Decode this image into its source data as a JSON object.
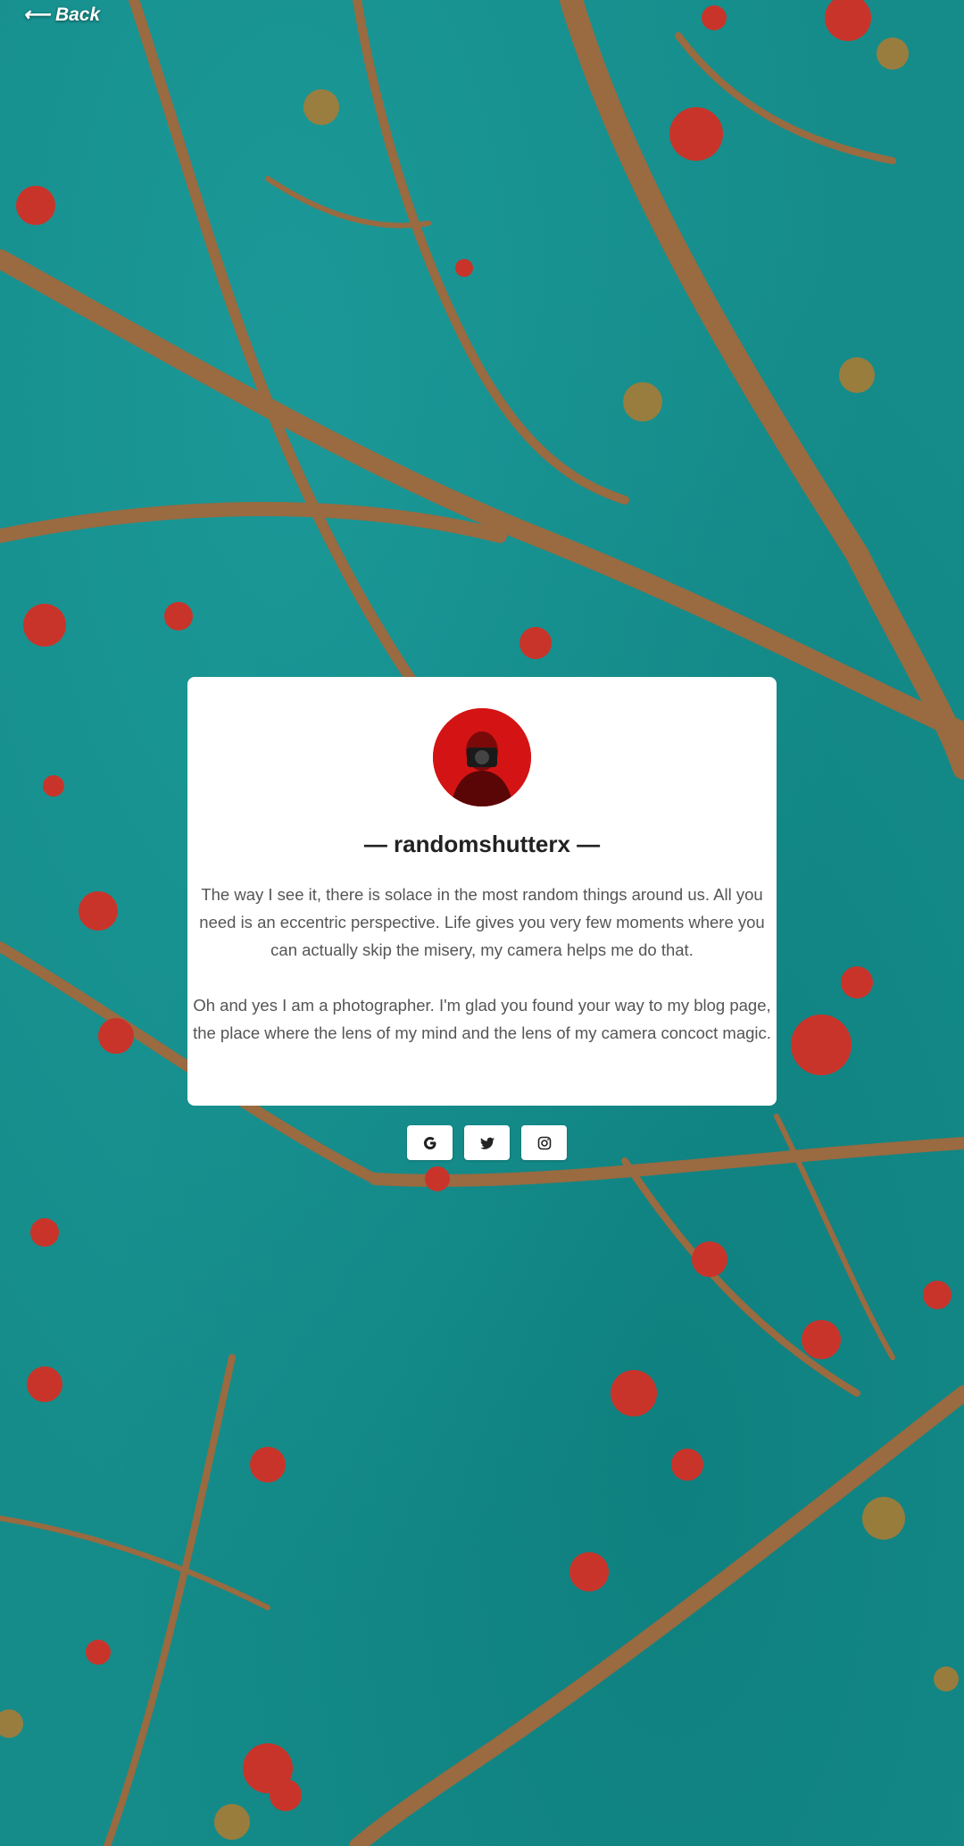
{
  "nav": {
    "back_label": "⟵ Back"
  },
  "profile": {
    "username_display": "— randomshutterx —",
    "bio": [
      "The way I see it, there is solace in the most random things around us. All you need is an eccentric perspective. Life gives you very few moments where you can actually skip the misery, my camera helps me do that.",
      "Oh and yes I am a photographer. I'm glad you found your way to my blog page, the place where the lens of my mind and the lens of my camera concoct magic."
    ]
  },
  "socials": [
    {
      "icon": "google-icon"
    },
    {
      "icon": "twitter-icon"
    },
    {
      "icon": "instagram-icon"
    }
  ],
  "colors": {
    "background_teal": "#158c8a",
    "card": "#ffffff",
    "avatar_red": "#d41414",
    "text_dark": "#222222",
    "text_body": "#555555"
  }
}
